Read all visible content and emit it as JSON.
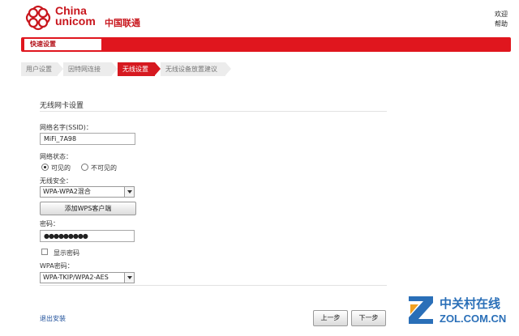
{
  "header": {
    "logo_text_en": "China\nunicom",
    "logo_text_cn": "中国联通",
    "welcome": "欢迎",
    "help": "帮助"
  },
  "nav": {
    "quick_setup": "快速设置"
  },
  "steps": [
    {
      "label": "用户设置",
      "active": false
    },
    {
      "label": "因特网连接",
      "active": false
    },
    {
      "label": "无线设置",
      "active": true
    },
    {
      "label": "无线设备放置建议",
      "active": false
    }
  ],
  "form": {
    "title": "无线网卡设置",
    "ssid_label": "网络名字(SSID)：",
    "ssid_value": "MiFi_7A98",
    "network_status_label": "网络状态：",
    "visible_label": "可见的",
    "invisible_label": "不可见的",
    "visible_selected": true,
    "security_label": "无线安全：",
    "security_value": "WPA-WPA2混合",
    "add_wps_button": "添加WPS客户端",
    "password_label": "密码：",
    "password_value": "●●●●●●●●●",
    "show_password_label": "显示密码",
    "show_password_checked": false,
    "wpa_label": "WPA密码：",
    "wpa_value": "WPA-TKIP/WPA2-AES"
  },
  "footer": {
    "exit_install": "退出安装",
    "prev": "上一步",
    "next": "下一步"
  },
  "watermark": {
    "cn": "中关村在线",
    "en": "ZOL.COM.CN"
  },
  "colors": {
    "brand_red": "#e0161e",
    "link_blue": "#1e4f9a",
    "watermark_blue": "#2a6fb8"
  }
}
